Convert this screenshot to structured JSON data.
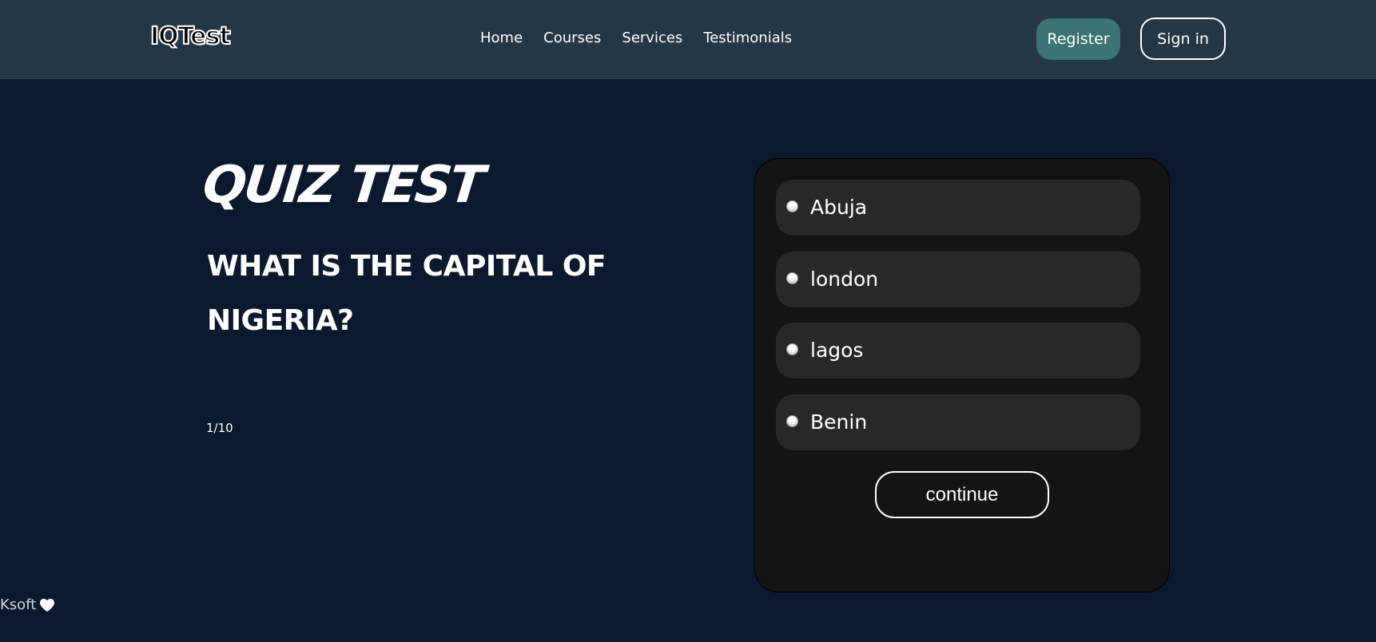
{
  "header": {
    "logo": "IQTest",
    "nav": [
      "Home",
      "Courses",
      "Services",
      "Testimonials"
    ],
    "register_label": "Register",
    "signin_label": "Sign in"
  },
  "hero": {
    "title": "QUIZ TEST",
    "question": "WHAT IS THE CAPITAL OF NIGERIA?",
    "progress": "1/10"
  },
  "quiz": {
    "options": [
      {
        "label": "Abuja"
      },
      {
        "label": "london"
      },
      {
        "label": "lagos"
      },
      {
        "label": "Benin"
      }
    ],
    "continue_label": "continue"
  },
  "footer": {
    "credit": "Ksoft",
    "icon": "heart-icon"
  },
  "colors": {
    "background": "#0a192f",
    "navbar": "#243746",
    "register_button": "#3a7474",
    "card": "#141414",
    "option": "#282828"
  }
}
